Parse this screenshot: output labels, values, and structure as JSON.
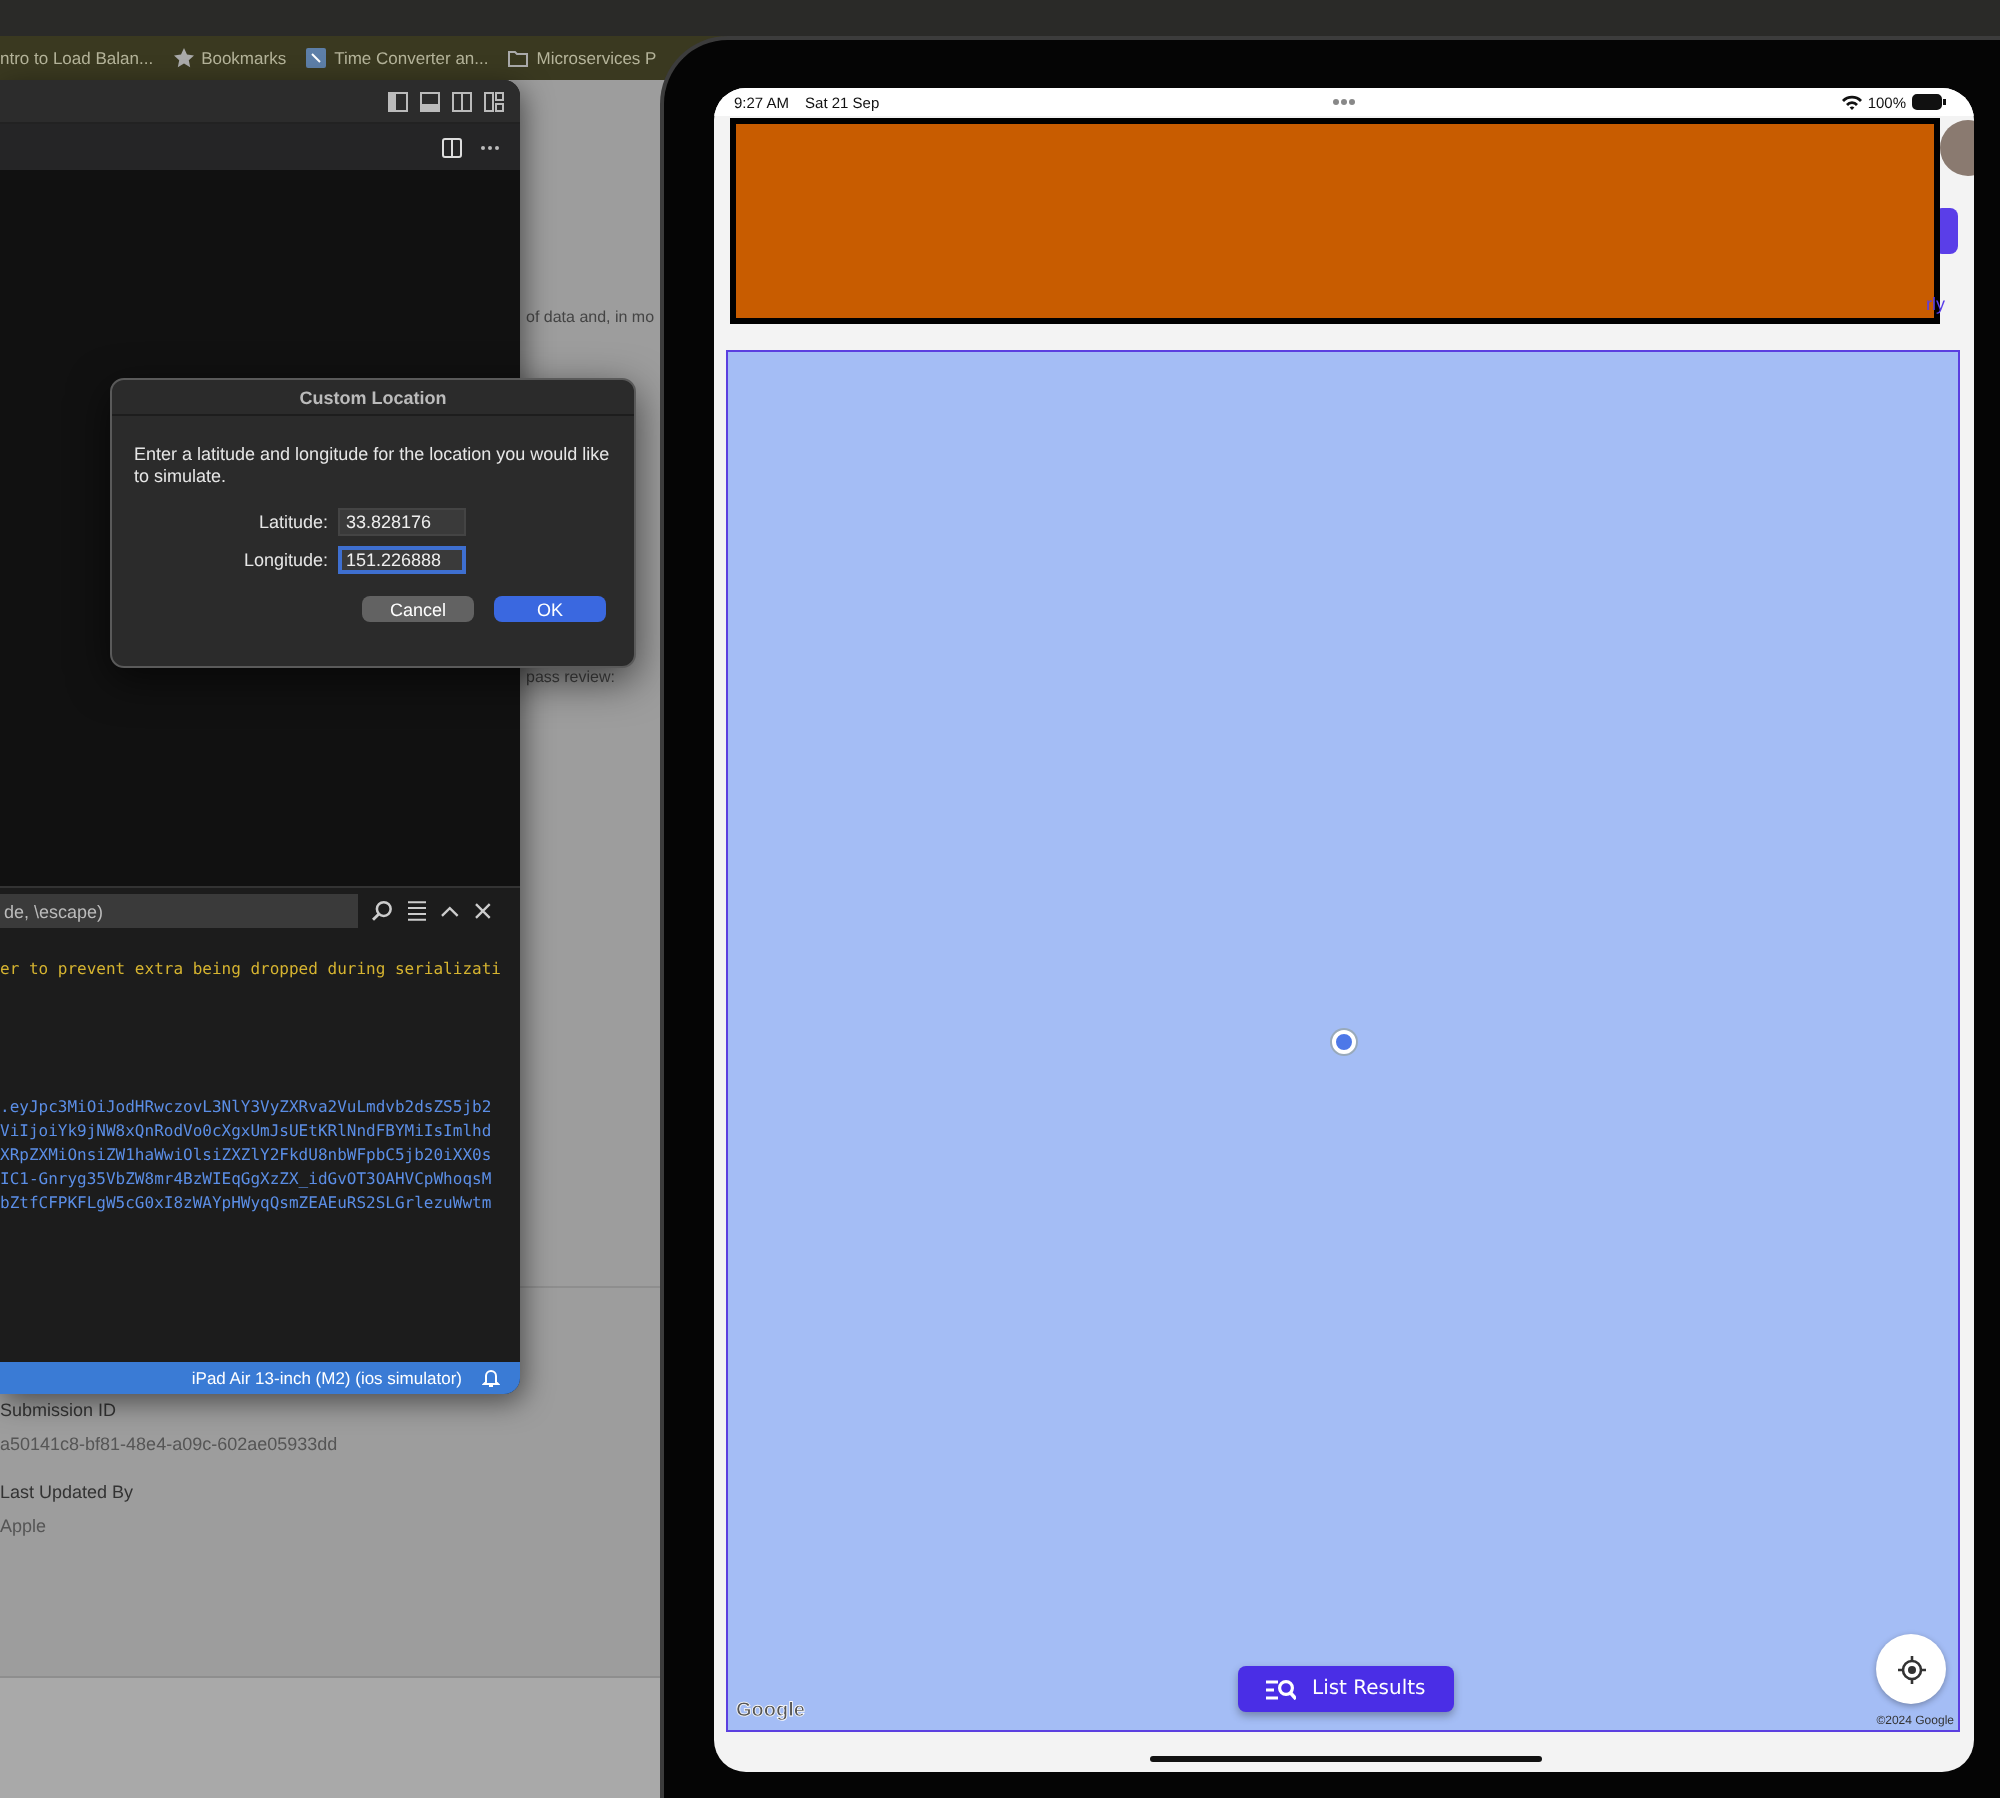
{
  "browser": {
    "bookmarks": [
      {
        "label": "ntro to Load Balan...",
        "kind": "page"
      },
      {
        "label": "Bookmarks",
        "kind": "star"
      },
      {
        "label": "Time Converter an...",
        "kind": "site"
      },
      {
        "label": "Microservices P",
        "kind": "folder"
      }
    ],
    "page": {
      "fragments": [
        "of data and, in mo",
        "pass review:"
      ],
      "fields": [
        {
          "label": "Submission ID",
          "value": "a50141c8-bf81-48e4-a09c-602ae05933dd"
        },
        {
          "label": "Last Updated By",
          "value": "Apple"
        }
      ]
    }
  },
  "editor": {
    "find_field": {
      "value": "de, \\escape)"
    },
    "terminal_lines": [
      {
        "kind": "warning",
        "text": "er to prevent extra being dropped during serializati"
      },
      {
        "kind": "token",
        "text": ".eyJpc3MiOiJodHRwczovL3NlY3VyZXRva2VuLmdvb2dsZS5jb2"
      },
      {
        "kind": "token",
        "text": "ViIjoiYk9jNW8xQnRodVo0cXgxUmJsUEtKRlNndFBYMiIsImlhd"
      },
      {
        "kind": "token",
        "text": "XRpZXMiOnsiZW1haWwiOlsiZXZlY2FkdU8nbWFpbC5jb20iXX0s"
      },
      {
        "kind": "token",
        "text": "IC1-Gnryg35VbZW8mr4BzWIEqGgXzZX_idGvOT3OAHVCpWhoqsM"
      },
      {
        "kind": "token",
        "text": "bZtfCFPKFLgW5cG0xI8zWAYpHWyqQsmZEAEuRS2SLGrlezuWwtm"
      }
    ],
    "status_bar": {
      "target": "iPad Air 13-inch (M2) (ios simulator)"
    }
  },
  "dialog": {
    "title": "Custom Location",
    "message": "Enter a latitude and longitude for the location you would like to simulate.",
    "fields": [
      {
        "label": "Latitude:",
        "value": "33.828176",
        "focused": false
      },
      {
        "label": "Longitude:",
        "value": "151.226888",
        "focused": true
      }
    ],
    "buttons": [
      {
        "label": "Cancel",
        "kind": "secondary"
      },
      {
        "label": "OK",
        "kind": "primary"
      }
    ]
  },
  "simulator": {
    "status_bar": {
      "time": "9:27 AM",
      "date": "Sat 21 Sep",
      "battery": "100%"
    },
    "side_link": "rly",
    "map": {
      "logo": "Google",
      "list_button": "List Results",
      "attribution": "©2024 Google"
    }
  }
}
